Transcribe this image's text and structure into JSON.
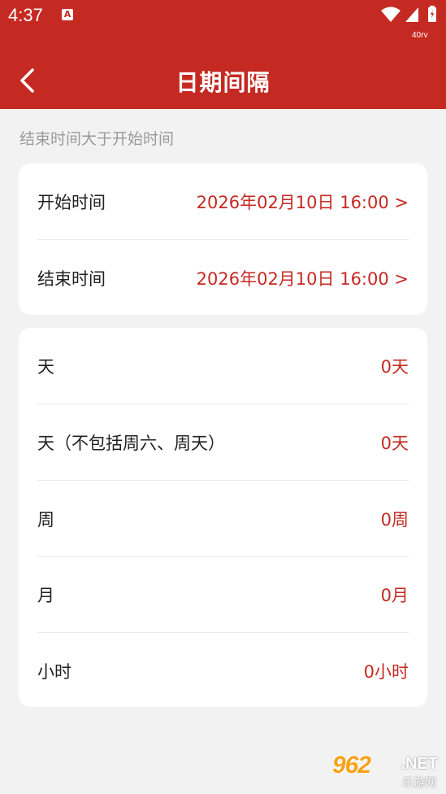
{
  "status_bar": {
    "time": "4:37",
    "notification_glyph": "A",
    "net_speed": "40rv",
    "icons": [
      "notification-icon",
      "wifi-icon",
      "signal-icon",
      "battery-icon"
    ]
  },
  "app_bar": {
    "title": "日期间隔",
    "back_icon": "chevron-left-icon"
  },
  "hint": "结束时间大于开始时间",
  "time_card": {
    "start": {
      "label": "开始时间",
      "value": "2026年02月10日 16:00 >"
    },
    "end": {
      "label": "结束时间",
      "value": "2026年02月10日 16:00 >"
    }
  },
  "results": [
    {
      "label": "天",
      "value": "0天"
    },
    {
      "label": "天（不包括周六、周天）",
      "value": "0天"
    },
    {
      "label": "周",
      "value": "0周"
    },
    {
      "label": "月",
      "value": "0月"
    },
    {
      "label": "小时",
      "value": "0小时"
    }
  ],
  "watermark": {
    "main": "962",
    "net": ".NET",
    "sub": "乐游网"
  },
  "colors": {
    "accent": "#c52a22",
    "background": "#f2f2f2",
    "card": "#ffffff",
    "hint_text": "#9a9a9a"
  }
}
